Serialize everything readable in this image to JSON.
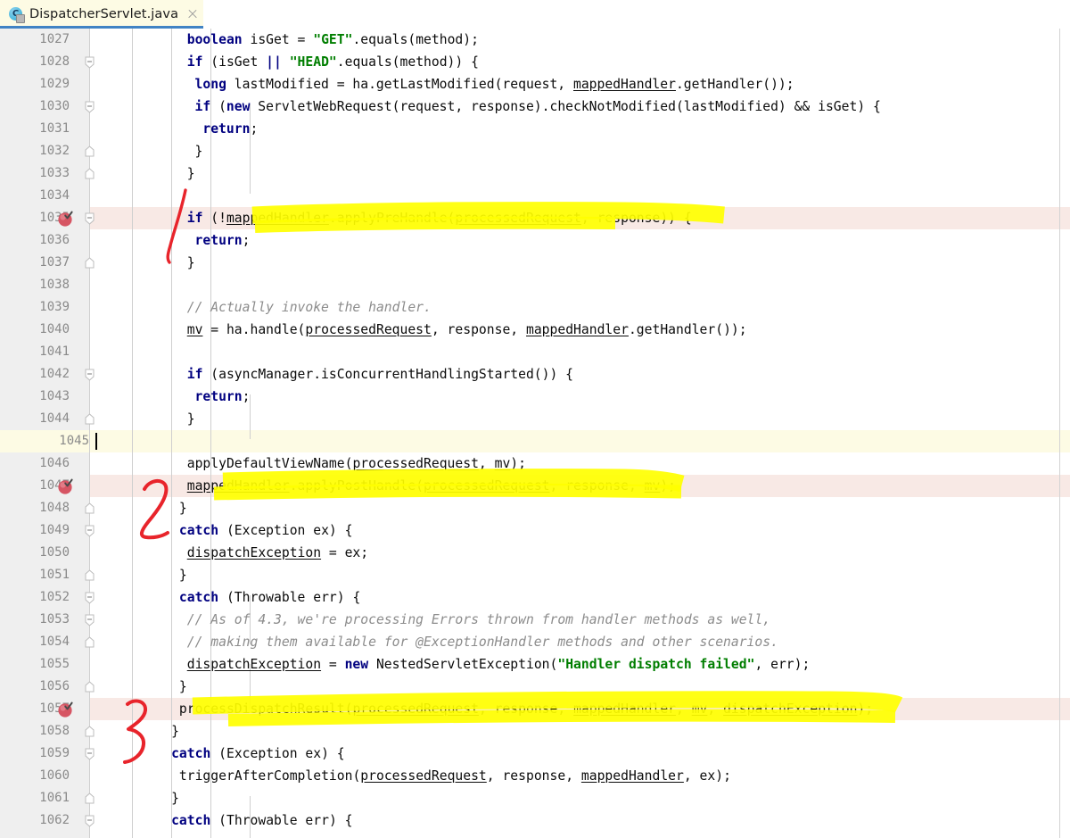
{
  "tab": {
    "title": "DispatcherServlet.java",
    "icon": "java-class-icon",
    "icon_letter": "C",
    "close_label": "×",
    "accent_color": "#4183c4",
    "background_color": "#fdfbe4"
  },
  "editor": {
    "first_line": 1027,
    "last_line": 1062,
    "line_height": 25,
    "caret_line": 1045,
    "breakpoint_lines": [
      1035,
      1047,
      1057
    ],
    "error_lines": [
      1035,
      1047,
      1057
    ],
    "error_line_color": "#f8e9e5",
    "caret_line_color": "#fdfbe4",
    "gutter_color": "#efefef",
    "line_number_color": "#8a8a8a",
    "keyword_color": "#000080",
    "string_color": "#007e00",
    "comment_color": "#8c8c8c",
    "marker_color": "#ffff00",
    "pen_color": "#e8242b",
    "lines": [
      {
        "n": 1027,
        "indent": 7,
        "tokens": [
          {
            "t": "boolean",
            "c": "kw"
          },
          {
            "t": " isGet = ",
            "c": "pln"
          },
          {
            "t": "\"GET\"",
            "c": "str"
          },
          {
            "t": ".equals(method);",
            "c": "pln"
          }
        ]
      },
      {
        "n": 1028,
        "indent": 7,
        "fold": "start",
        "tokens": [
          {
            "t": "if",
            "c": "kw"
          },
          {
            "t": " (isGet ",
            "c": "pln"
          },
          {
            "t": "||",
            "c": "kw"
          },
          {
            "t": " ",
            "c": "pln"
          },
          {
            "t": "\"HEAD\"",
            "c": "str"
          },
          {
            "t": ".equals(method)) {",
            "c": "pln"
          }
        ]
      },
      {
        "n": 1029,
        "indent": 8,
        "tokens": [
          {
            "t": "long",
            "c": "kw"
          },
          {
            "t": " lastModified = ha.getLastModified(request, ",
            "c": "pln"
          },
          {
            "t": "mappedHandler",
            "c": "fld"
          },
          {
            "t": ".getHandler());",
            "c": "pln"
          }
        ]
      },
      {
        "n": 1030,
        "indent": 8,
        "fold": "start",
        "tokens": [
          {
            "t": "if",
            "c": "kw"
          },
          {
            "t": " (",
            "c": "pln"
          },
          {
            "t": "new",
            "c": "kw"
          },
          {
            "t": " ServletWebRequest(request, response).checkNotModified(lastModified) && isGet) {",
            "c": "pln"
          }
        ]
      },
      {
        "n": 1031,
        "indent": 9,
        "tokens": [
          {
            "t": "return",
            "c": "kw"
          },
          {
            "t": ";",
            "c": "pln"
          }
        ]
      },
      {
        "n": 1032,
        "indent": 8,
        "fold": "end",
        "tokens": [
          {
            "t": "}",
            "c": "pln"
          }
        ]
      },
      {
        "n": 1033,
        "indent": 7,
        "fold": "end",
        "tokens": [
          {
            "t": "}",
            "c": "pln"
          }
        ]
      },
      {
        "n": 1034,
        "indent": 0,
        "tokens": []
      },
      {
        "n": 1035,
        "indent": 7,
        "fold": "start",
        "tokens": [
          {
            "t": "if",
            "c": "kw"
          },
          {
            "t": " (!",
            "c": "pln"
          },
          {
            "t": "mappedHandler",
            "c": "fld"
          },
          {
            "t": ".applyPreHandle(",
            "c": "pln"
          },
          {
            "t": "processedRequest",
            "c": "fld"
          },
          {
            "t": ", response)) {",
            "c": "pln"
          }
        ]
      },
      {
        "n": 1036,
        "indent": 8,
        "tokens": [
          {
            "t": "return",
            "c": "kw"
          },
          {
            "t": ";",
            "c": "pln"
          }
        ]
      },
      {
        "n": 1037,
        "indent": 7,
        "fold": "end",
        "tokens": [
          {
            "t": "}",
            "c": "pln"
          }
        ]
      },
      {
        "n": 1038,
        "indent": 0,
        "tokens": []
      },
      {
        "n": 1039,
        "indent": 7,
        "tokens": [
          {
            "t": "// Actually invoke the handler.",
            "c": "cmt"
          }
        ]
      },
      {
        "n": 1040,
        "indent": 7,
        "tokens": [
          {
            "t": "mv",
            "c": "fld"
          },
          {
            "t": " = ha.handle(",
            "c": "pln"
          },
          {
            "t": "processedRequest",
            "c": "fld"
          },
          {
            "t": ", response, ",
            "c": "pln"
          },
          {
            "t": "mappedHandler",
            "c": "fld"
          },
          {
            "t": ".getHandler());",
            "c": "pln"
          }
        ]
      },
      {
        "n": 1041,
        "indent": 0,
        "tokens": []
      },
      {
        "n": 1042,
        "indent": 7,
        "fold": "start",
        "tokens": [
          {
            "t": "if",
            "c": "kw"
          },
          {
            "t": " (asyncManager.isConcurrentHandlingStarted()) {",
            "c": "pln"
          }
        ]
      },
      {
        "n": 1043,
        "indent": 8,
        "tokens": [
          {
            "t": "return",
            "c": "kw"
          },
          {
            "t": ";",
            "c": "pln"
          }
        ]
      },
      {
        "n": 1044,
        "indent": 7,
        "fold": "end",
        "tokens": [
          {
            "t": "}",
            "c": "pln"
          }
        ]
      },
      {
        "n": 1045,
        "indent": 0,
        "tokens": []
      },
      {
        "n": 1046,
        "indent": 7,
        "tokens": [
          {
            "t": "applyDefaultViewName(",
            "c": "pln"
          },
          {
            "t": "processedRequest",
            "c": "fld"
          },
          {
            "t": ", ",
            "c": "pln"
          },
          {
            "t": "mv",
            "c": "fld"
          },
          {
            "t": ");",
            "c": "pln"
          }
        ]
      },
      {
        "n": 1047,
        "indent": 7,
        "tokens": [
          {
            "t": "mappedHandler",
            "c": "fld"
          },
          {
            "t": ".applyPostHandle(",
            "c": "pln"
          },
          {
            "t": "processedRequest",
            "c": "fld"
          },
          {
            "t": ", response, ",
            "c": "pln"
          },
          {
            "t": "mv",
            "c": "fld"
          },
          {
            "t": ");",
            "c": "pln"
          }
        ]
      },
      {
        "n": 1048,
        "indent": 6,
        "fold": "end",
        "tokens": [
          {
            "t": "}",
            "c": "pln"
          }
        ]
      },
      {
        "n": 1049,
        "indent": 6,
        "fold": "start",
        "tokens": [
          {
            "t": "catch",
            "c": "kw"
          },
          {
            "t": " (Exception ex) {",
            "c": "pln"
          }
        ]
      },
      {
        "n": 1050,
        "indent": 7,
        "tokens": [
          {
            "t": "dispatchException",
            "c": "fld"
          },
          {
            "t": " = ex;",
            "c": "pln"
          }
        ]
      },
      {
        "n": 1051,
        "indent": 6,
        "fold": "end",
        "tokens": [
          {
            "t": "}",
            "c": "pln"
          }
        ]
      },
      {
        "n": 1052,
        "indent": 6,
        "fold": "start",
        "tokens": [
          {
            "t": "catch",
            "c": "kw"
          },
          {
            "t": " (Throwable err) {",
            "c": "pln"
          }
        ]
      },
      {
        "n": 1053,
        "indent": 7,
        "fold": "start",
        "tokens": [
          {
            "t": "// As of 4.3, we're processing Errors thrown from handler methods as well,",
            "c": "cmt"
          }
        ]
      },
      {
        "n": 1054,
        "indent": 7,
        "fold": "end",
        "tokens": [
          {
            "t": "// making them available for @ExceptionHandler methods and other scenarios.",
            "c": "cmt"
          }
        ]
      },
      {
        "n": 1055,
        "indent": 7,
        "tokens": [
          {
            "t": "dispatchException",
            "c": "fld"
          },
          {
            "t": " = ",
            "c": "pln"
          },
          {
            "t": "new",
            "c": "kw"
          },
          {
            "t": " NestedServletException(",
            "c": "pln"
          },
          {
            "t": "\"Handler dispatch failed\"",
            "c": "str"
          },
          {
            "t": ", err);",
            "c": "pln"
          }
        ]
      },
      {
        "n": 1056,
        "indent": 6,
        "fold": "end",
        "tokens": [
          {
            "t": "}",
            "c": "pln"
          }
        ]
      },
      {
        "n": 1057,
        "indent": 6,
        "tokens": [
          {
            "t": "processDispatchResult(",
            "c": "pln"
          },
          {
            "t": "processedRequest",
            "c": "fld"
          },
          {
            "t": ", response, ",
            "c": "pln"
          },
          {
            "t": "mappedHandler",
            "c": "fld"
          },
          {
            "t": ", ",
            "c": "pln"
          },
          {
            "t": "mv",
            "c": "fld"
          },
          {
            "t": ", ",
            "c": "pln"
          },
          {
            "t": "dispatchException",
            "c": "fld"
          },
          {
            "t": ");",
            "c": "pln"
          }
        ]
      },
      {
        "n": 1058,
        "indent": 5,
        "fold": "end",
        "tokens": [
          {
            "t": "}",
            "c": "pln"
          }
        ]
      },
      {
        "n": 1059,
        "indent": 5,
        "fold": "start",
        "tokens": [
          {
            "t": "catch",
            "c": "kw"
          },
          {
            "t": " (Exception ex) {",
            "c": "pln"
          }
        ]
      },
      {
        "n": 1060,
        "indent": 6,
        "tokens": [
          {
            "t": "triggerAfterCompletion(",
            "c": "pln"
          },
          {
            "t": "processedRequest",
            "c": "fld"
          },
          {
            "t": ", response, ",
            "c": "pln"
          },
          {
            "t": "mappedHandler",
            "c": "fld"
          },
          {
            "t": ", ex);",
            "c": "pln"
          }
        ]
      },
      {
        "n": 1061,
        "indent": 5,
        "fold": "end",
        "tokens": [
          {
            "t": "}",
            "c": "pln"
          }
        ]
      },
      {
        "n": 1062,
        "indent": 5,
        "fold": "start",
        "tokens": [
          {
            "t": "catch",
            "c": "kw"
          },
          {
            "t": " (Throwable err) {",
            "c": "pln"
          }
        ]
      }
    ]
  },
  "annotations": {
    "pen_color": "#e8242b",
    "marker_color": "#ffff00",
    "numbers": [
      {
        "label": "1",
        "line": 1035
      },
      {
        "label": "2",
        "line": 1047
      },
      {
        "label": "3",
        "line": 1057
      }
    ],
    "highlights": [
      {
        "line": 1035,
        "text": "mappedHandler.applyPreHandle(processedRequest, response))"
      },
      {
        "line": 1047,
        "text": "mappedHandler.applyPostHandle(processedRequest, response, mv)"
      },
      {
        "line": 1057,
        "text": "processDispatchResult(processedRequest, response, mappedHandler, mv, dispatchException)"
      }
    ]
  }
}
